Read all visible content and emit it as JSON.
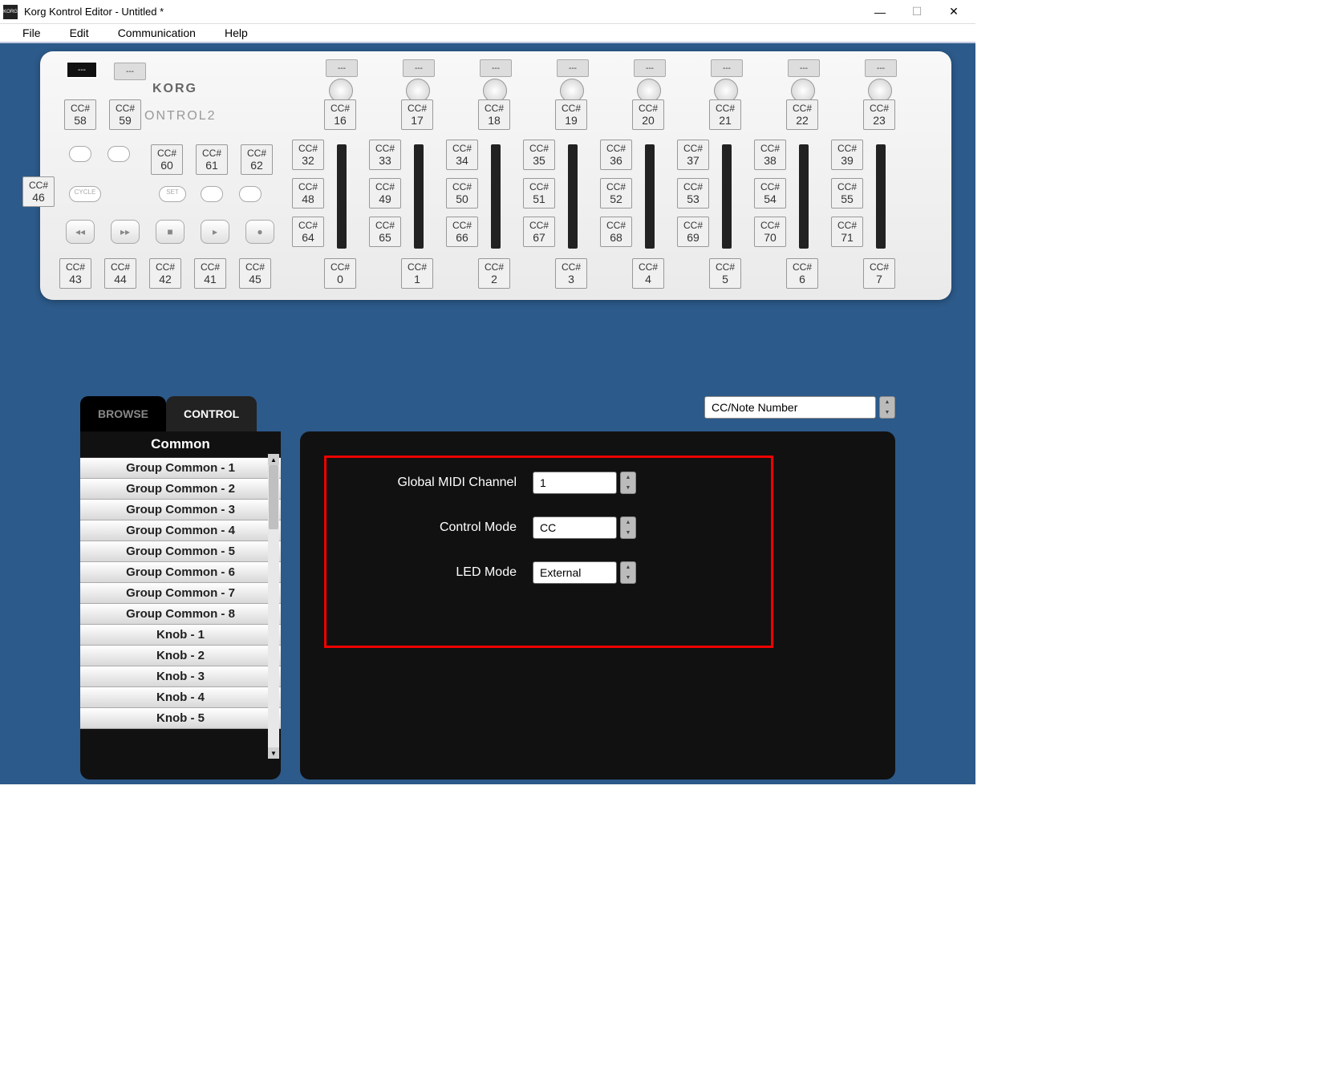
{
  "window": {
    "title": "Korg Kontrol Editor - Untitled *"
  },
  "menubar": [
    "File",
    "Edit",
    "Communication",
    "Help"
  ],
  "device": {
    "brand": "KORG",
    "model": "ONTROL2"
  },
  "knobs": [
    {
      "cc": "16",
      "sl": "0"
    },
    {
      "cc": "17",
      "sl": "1"
    },
    {
      "cc": "18",
      "sl": "2"
    },
    {
      "cc": "19",
      "sl": "3"
    },
    {
      "cc": "20",
      "sl": "4"
    },
    {
      "cc": "21",
      "sl": "5"
    },
    {
      "cc": "22",
      "sl": "6"
    },
    {
      "cc": "23",
      "sl": "7"
    }
  ],
  "solo_row": [
    "32",
    "33",
    "34",
    "35",
    "36",
    "37",
    "38",
    "39"
  ],
  "mute_row": [
    "48",
    "49",
    "50",
    "51",
    "52",
    "53",
    "54",
    "55"
  ],
  "rec_row": [
    "64",
    "65",
    "66",
    "67",
    "68",
    "69",
    "70",
    "71"
  ],
  "left_top": [
    "58",
    "59"
  ],
  "left_mid": [
    "60",
    "61",
    "62"
  ],
  "cycle_cc": "46",
  "transport_cc": [
    "43",
    "44",
    "42",
    "41",
    "45"
  ],
  "combo": {
    "value": "CC/Note Number"
  },
  "tabs": {
    "browse": "BROWSE",
    "control": "CONTROL"
  },
  "sidebar": {
    "header": "Common",
    "items": [
      "Group Common - 1",
      "Group Common - 2",
      "Group Common - 3",
      "Group Common - 4",
      "Group Common - 5",
      "Group Common - 6",
      "Group Common - 7",
      "Group Common - 8",
      "Knob - 1",
      "Knob - 2",
      "Knob - 3",
      "Knob - 4",
      "Knob - 5"
    ]
  },
  "params": {
    "midi_label": "Global MIDI Channel",
    "midi_value": "1",
    "ctrl_label": "Control Mode",
    "ctrl_value": "CC",
    "led_label": "LED Mode",
    "led_value": "External"
  },
  "cc_text": "CC#"
}
